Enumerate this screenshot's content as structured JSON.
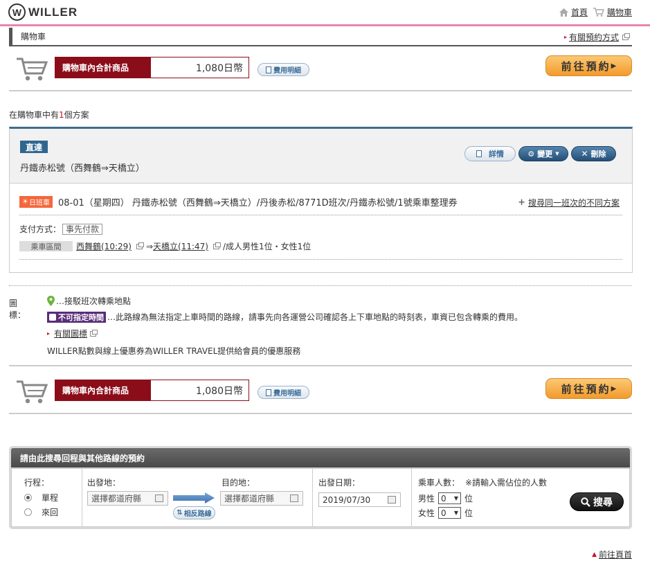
{
  "header": {
    "logo_letter": "W",
    "logo_text": "WILLER",
    "nav": [
      {
        "label": "首頁",
        "icon": "home-icon"
      },
      {
        "label": "購物車",
        "icon": "cart-icon"
      }
    ]
  },
  "subhead": {
    "title": "購物車",
    "link": "有關預約方式"
  },
  "cart_summary": {
    "label": "購物車內合計商品",
    "total": "1,080日幣",
    "fee_button": "費用明細",
    "proceed_button": "前往預約"
  },
  "count_line": {
    "prefix": "在購物車中有",
    "count": "1",
    "unit": "個",
    "suffix": "方案"
  },
  "plan": {
    "badge": "直達",
    "route": "丹鐵赤松號（西舞鶴⇒天橋立）",
    "buttons": {
      "detail": "詳情",
      "change": "變更",
      "delete": "刪除"
    },
    "day_badge": "日班車",
    "trip": "08-01（星期四） 丹鐵赤松號（西舞鶴⇒天橋立）/丹後赤松/8771D班次/丹鐵赤松號/1號乘車整理券",
    "search_same": "搜尋同一班次的不同方案",
    "payment_label": "支付方式：",
    "payment_value": "事先付款",
    "segment_label": "乘車區間",
    "from_stop": "西舞鶴(10:29)",
    "arrow": "⇒",
    "to_stop": "天橋立(11:47)",
    "passengers": "/成人男性1位・女性1位"
  },
  "legend": {
    "title": "圖標：",
    "transfer": "…接駁班次轉乘地點",
    "no_time_tag": "不可指定時間",
    "no_time_desc": "…此路線為無法指定上車時間的路線，請事先向各運營公司確認各上下車地點的時刻表，車資已包含轉乘的費用。",
    "icon_link": "有關圖標",
    "points": "WILLER點數與線上優惠券為WILLER TRAVEL提供給會員的優惠服務"
  },
  "search_box": {
    "title": "請由此搜尋回程與其他路線的預約",
    "trip_label": "行程：",
    "trip_options": [
      "單程",
      "來回"
    ],
    "trip_selected": "單程",
    "from_label": "出發地：",
    "from_placeholder": "選擇都道府縣",
    "to_label": "目的地：",
    "to_placeholder": "選擇都道府縣",
    "swap_button": "相反路線",
    "date_label": "出發日期：",
    "date_value": "2019/07/30",
    "passengers_label": "乘車人數：",
    "passengers_note": "※請輸入需佔位的人數",
    "male_label": "男性",
    "male_value": "0",
    "female_label": "女性",
    "female_value": "0",
    "unit": "位",
    "search_button": "搜尋"
  },
  "footer": {
    "page_top": "前往頁首"
  },
  "colors": {
    "brand_pink": "#e985ae",
    "cart_red": "#8b0d1a",
    "accent_blue": "#2f6690",
    "proceed_orange": "#f39a2c",
    "day_badge": "#f4673d",
    "no_time_purple": "#5a2d79"
  }
}
